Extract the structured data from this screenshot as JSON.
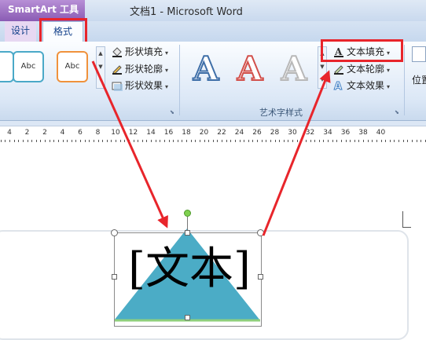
{
  "titlebar": {
    "context_tab_label": "SmartArt 工具",
    "window_title": "文档1 - Microsoft Word"
  },
  "tabs": [
    {
      "label": "设计",
      "selected": false
    },
    {
      "label": "格式",
      "selected": true
    }
  ],
  "ribbon": {
    "shape_styles": [
      {
        "label": "Abc",
        "border_color": "#4aa9c8"
      },
      {
        "label": "Abc",
        "border_color": "#f0923c"
      }
    ],
    "shape_commands": {
      "fill": "形状填充",
      "outline": "形状轮廓",
      "effects": "形状效果"
    },
    "wordart_styles": [
      {
        "glyph": "A",
        "style": "blue-outline"
      },
      {
        "glyph": "A",
        "style": "red-outline"
      },
      {
        "glyph": "A",
        "style": "gray-outline"
      }
    ],
    "wordart_group_label": "艺术字样式",
    "text_commands": {
      "fill": "文本填充",
      "outline": "文本轮廓",
      "effects": "文本效果"
    },
    "position_label": "位置"
  },
  "ruler": {
    "labels": [
      "4",
      "2",
      "2",
      "4",
      "6",
      "8",
      "10",
      "12",
      "14",
      "16",
      "18",
      "20",
      "22",
      "24",
      "26",
      "28",
      "30",
      "32",
      "34",
      "36",
      "38",
      "40"
    ]
  },
  "document": {
    "shape_text": "[文本]",
    "shape_color": "#4bacc6"
  },
  "colors": {
    "accent_purple": "#8a5cb4",
    "highlight_red": "#e8252b"
  }
}
